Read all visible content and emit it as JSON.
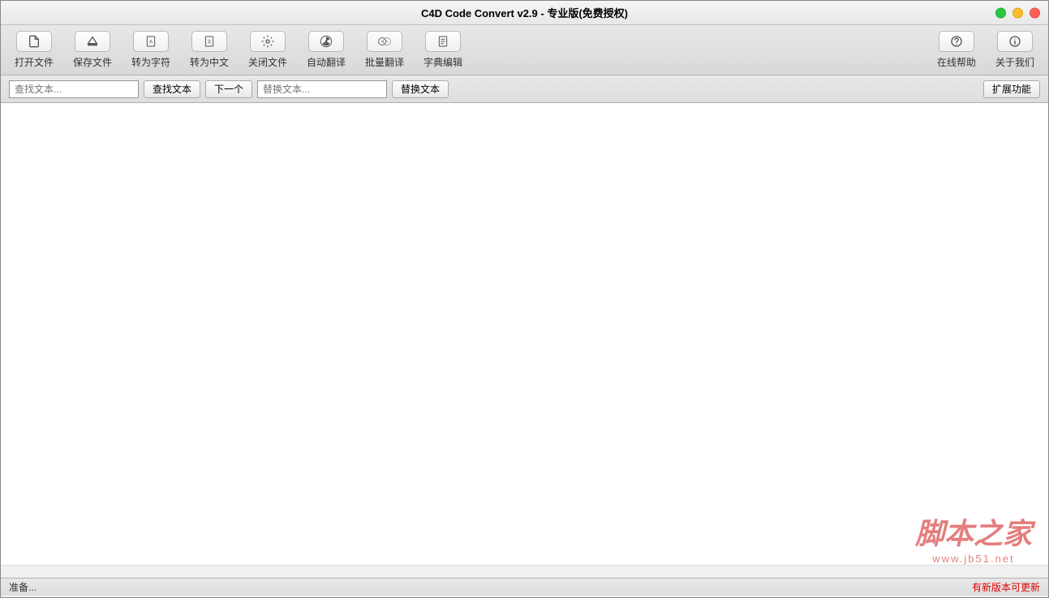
{
  "window": {
    "title": "C4D Code Convert v2.9 - 专业版(免费授权)"
  },
  "toolbar": {
    "open_file": "打开文件",
    "save_file": "保存文件",
    "to_chars": "转为字符",
    "to_chinese": "转为中文",
    "close_file": "关闭文件",
    "auto_translate": "自动翻译",
    "batch_translate": "批量翻译",
    "dict_edit": "字典编辑",
    "online_help": "在线帮助",
    "about_us": "关于我们"
  },
  "search": {
    "find_placeholder": "查找文本...",
    "find_btn": "查找文本",
    "next_btn": "下一个",
    "replace_placeholder": "替换文本...",
    "replace_btn": "替换文本",
    "expand_btn": "扩展功能"
  },
  "status": {
    "ready": "准备...",
    "update": "有新版本可更新"
  },
  "watermark": {
    "main": "脚本之家",
    "sub": "www.jb51.net"
  }
}
